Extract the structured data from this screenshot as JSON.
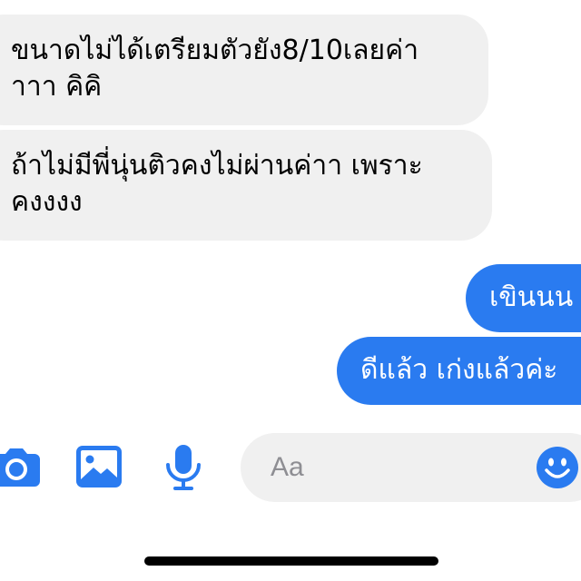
{
  "conversation": {
    "messages": [
      {
        "direction": "incoming",
        "text": "ขนาดไม่ได้เตรียมตัวยัง8/10เลยค่า\nาาา คิคิ"
      },
      {
        "direction": "incoming",
        "text": "ถ้าไม่มีพี่นุ่นติวคงไม่ผ่านค่าา เพราะ\nคงงงง"
      },
      {
        "direction": "outgoing",
        "text": "เขินนน"
      },
      {
        "direction": "outgoing",
        "text": "ดีแล้ว เก่งแล้วค่ะ"
      }
    ]
  },
  "composer": {
    "placeholder": "Aa",
    "value": ""
  },
  "toolbar": {
    "icons": [
      "camera-icon",
      "photo-icon",
      "microphone-icon",
      "emoji-icon"
    ]
  },
  "colors": {
    "accent": "#2a7bf0",
    "incoming_bubble": "#f0f0f0",
    "outgoing_bubble": "#2a7bf0",
    "background": "#ffffff"
  }
}
